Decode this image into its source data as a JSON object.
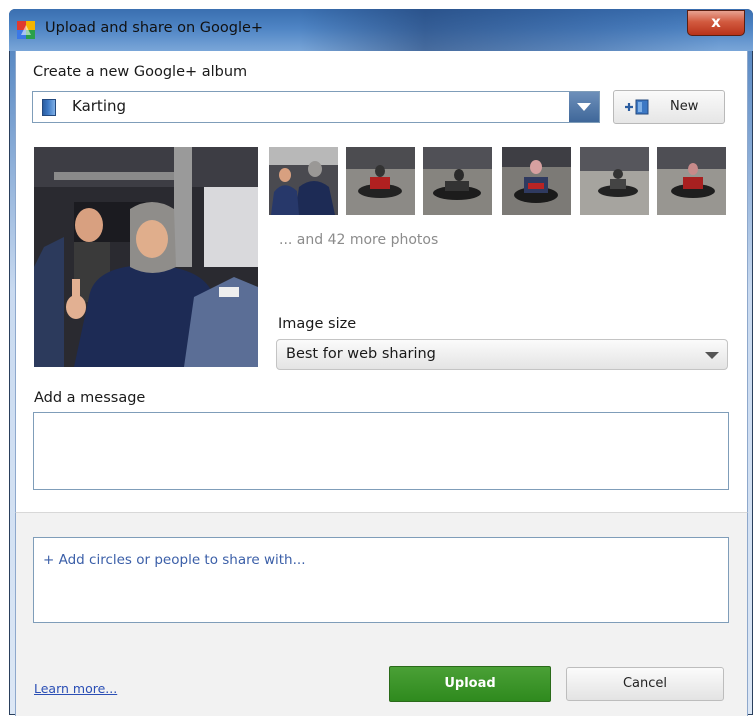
{
  "window": {
    "title": "Upload and share on Google+",
    "close_label": "x"
  },
  "album": {
    "heading": "Create a new Google+ album",
    "selected": "Karting",
    "new_button": "New"
  },
  "photos": {
    "more_text": "... and 42 more photos",
    "thumbnail_count": 6
  },
  "image_size": {
    "label": "Image size",
    "selected": "Best for web sharing"
  },
  "message": {
    "label": "Add a message",
    "value": ""
  },
  "share": {
    "placeholder": "+ Add circles or people to share with..."
  },
  "footer": {
    "learn_more": "Learn more...",
    "upload": "Upload",
    "cancel": "Cancel"
  },
  "colors": {
    "upload_green": "#2f8a1e",
    "link_blue": "#2b4fb5",
    "title_bar_blue": "#4e84c4"
  }
}
